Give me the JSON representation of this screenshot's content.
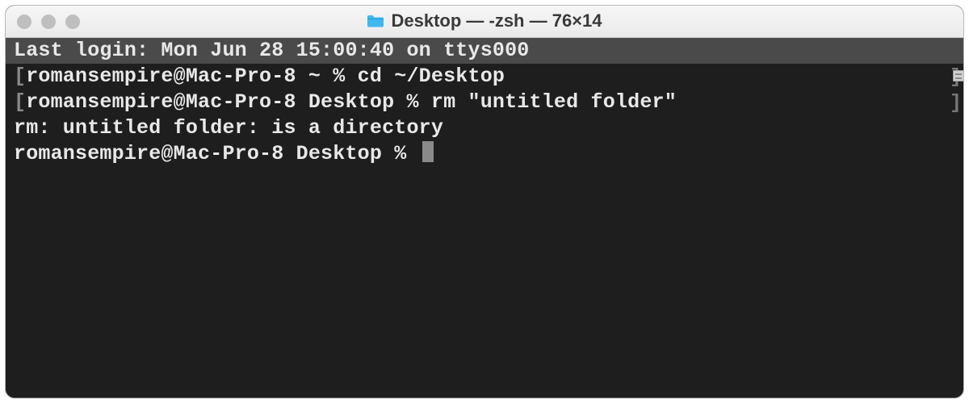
{
  "window": {
    "title": "Desktop — -zsh — 76×14"
  },
  "terminal": {
    "last_login": "Last login: Mon Jun 28 15:00:40 on ttys000",
    "line2_prompt": "romansempire@Mac-Pro-8 ~ % ",
    "line2_cmd": "cd ~/Desktop",
    "line3_prompt": "romansempire@Mac-Pro-8 Desktop % ",
    "line3_cmd": "rm \"untitled folder\"",
    "line4": "rm: untitled folder: is a directory",
    "line5_prompt": "romansempire@Mac-Pro-8 Desktop % "
  }
}
